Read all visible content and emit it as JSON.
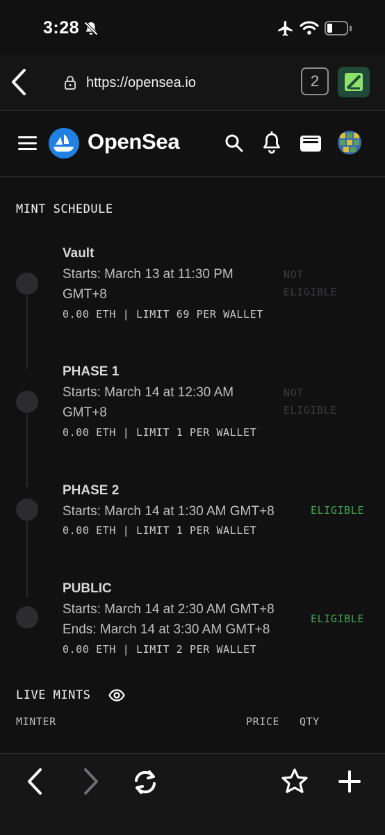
{
  "status_bar": {
    "time": "3:28"
  },
  "browser": {
    "url": "https://opensea.io",
    "tab_count": "2"
  },
  "header": {
    "brand": "OpenSea"
  },
  "mint_schedule": {
    "title": "MINT SCHEDULE",
    "phases": [
      {
        "name": "Vault",
        "starts": "Starts: March 13 at 11:30 PM",
        "starts_cont": "GMT+8",
        "ends": "",
        "price": "0.00 ETH | LIMIT 69 PER WALLET",
        "status_line1": "NOT",
        "status_line2": "ELIGIBLE"
      },
      {
        "name": "PHASE 1",
        "starts": "Starts: March 14 at 12:30 AM",
        "starts_cont": "GMT+8",
        "ends": "",
        "price": "0.00 ETH | LIMIT 1 PER WALLET",
        "status_line1": "NOT",
        "status_line2": "ELIGIBLE"
      },
      {
        "name": "PHASE 2",
        "starts": "Starts: March 14 at 1:30 AM GMT+8",
        "starts_cont": "",
        "ends": "",
        "price": "0.00 ETH | LIMIT 1 PER WALLET",
        "status_line1": "ELIGIBLE",
        "status_line2": ""
      },
      {
        "name": "PUBLIC",
        "starts": "Starts: March 14 at 2:30 AM GMT+8",
        "starts_cont": "",
        "ends": "Ends: March 14 at 3:30 AM GMT+8",
        "price": "0.00 ETH | LIMIT 2 PER WALLET",
        "status_line1": "ELIGIBLE",
        "status_line2": ""
      }
    ]
  },
  "live_mints": {
    "title": "LIVE MINTS",
    "columns": {
      "minter": "MINTER",
      "price": "PRICE",
      "qty": "QTY"
    }
  },
  "colors": {
    "background": "#111112",
    "eligible": "#3fa652",
    "opensea_blue": "#2081e2"
  }
}
